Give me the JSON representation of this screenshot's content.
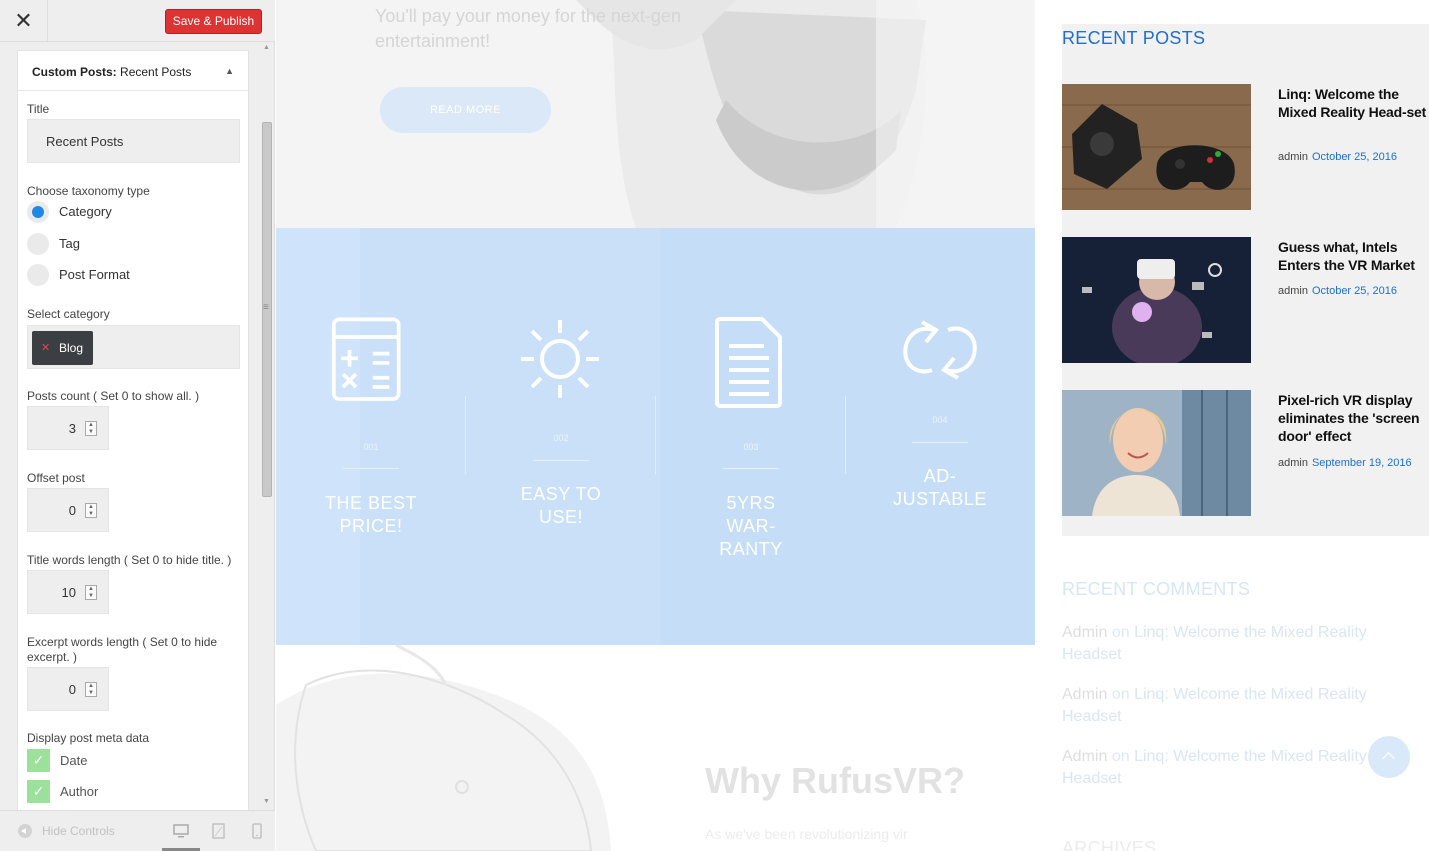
{
  "sidebar": {
    "close_icon": "close-icon",
    "publish_label": "Save & Publish",
    "widget": {
      "title_prefix": "Custom Posts:",
      "title_name": " Recent Posts",
      "title_label": "Title",
      "title_value": "Recent Posts",
      "taxonomy_label": "Choose taxonomy type",
      "taxonomy_options": [
        "Category",
        "Tag",
        "Post Format"
      ],
      "taxonomy_selected": "Category",
      "category_label": "Select category",
      "category_tag": "Blog",
      "posts_count_label": "Posts count ( Set 0 to show all. )",
      "posts_count": "3",
      "offset_label": "Offset post",
      "offset": "0",
      "title_words_label": "Title words length ( Set 0 to hide title. )",
      "title_words": "10",
      "excerpt_label_1": "Excerpt words length ( Set 0 to hide",
      "excerpt_label_2": "excerpt. )",
      "excerpt_words": "0",
      "meta_label": "Display post meta data",
      "meta_options": [
        "Date",
        "Author"
      ]
    },
    "footer": {
      "hide_controls": "Hide Controls",
      "devices": [
        "desktop-icon",
        "tablet-icon",
        "mobile-icon"
      ]
    }
  },
  "preview": {
    "hero_text_1": "You'll pay your money for the next-gen",
    "hero_text_2": "entertainment!",
    "read_more": "READ MORE",
    "features": [
      {
        "num": "001",
        "title": "THE BEST PRICE!",
        "icon": "calculator-icon"
      },
      {
        "num": "002",
        "title": "EASY TO USE!",
        "icon": "sun-icon"
      },
      {
        "num": "003",
        "title": "5YRS WAR-RANTY",
        "icon": "document-icon"
      },
      {
        "num": "004",
        "title": "AD-JUSTABLE",
        "icon": "refresh-icon"
      }
    ],
    "why_title": "Why RufusVR?",
    "why_sub": "As we've been revolutionizing vir",
    "recent_posts": {
      "title": "RECENT POSTS",
      "posts": [
        {
          "title": "Linq: Welcome the Mixed Reality Head-set",
          "author": "admin",
          "date": "October 25, 2016"
        },
        {
          "title": "Guess what, Intels Enters the VR Market",
          "author": "admin",
          "date": "October 25, 2016"
        },
        {
          "title": "Pixel-rich VR display eliminates the 'screen door' effect",
          "author": "admin",
          "date": "September 19, 2016"
        }
      ]
    },
    "recent_comments": {
      "title": "RECENT COMMENTS",
      "items": [
        {
          "author": "Admin",
          "on": "on",
          "link": "Linq: Welcome the Mixed Reality Headset"
        },
        {
          "author": "Admin",
          "on": "on",
          "link": "Linq: Welcome the Mixed Reality Headset"
        },
        {
          "author": "Admin",
          "on": "on",
          "link": "Linq: Welcome the Mixed Reality Headset"
        }
      ]
    },
    "archives_title": "ARCHIVES"
  },
  "colors": {
    "accent": "#1e6fd0",
    "publish": "#dd3333",
    "feature_bg": "#cfe4fa",
    "check": "#9be09b"
  }
}
